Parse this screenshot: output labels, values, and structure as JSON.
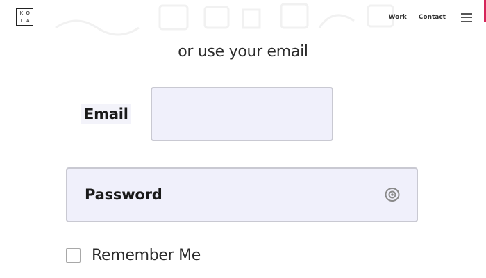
{
  "header": {
    "logo_letters": [
      "K",
      "O",
      "T",
      "A"
    ],
    "nav": {
      "work_label": "Work",
      "contact_label": "Contact"
    },
    "menu_icon": "hamburger-menu-icon"
  },
  "login": {
    "subtitle": "or use your email",
    "email": {
      "label": "Email",
      "value": "",
      "placeholder": ""
    },
    "password": {
      "label": "Password",
      "icon": "eye-icon"
    },
    "remember_me": {
      "label": "Remember Me",
      "checked": false
    }
  },
  "colors": {
    "input_background": "#f0f0fb",
    "input_border": "#c9c9d2",
    "accent_edge": "#d6245a"
  }
}
